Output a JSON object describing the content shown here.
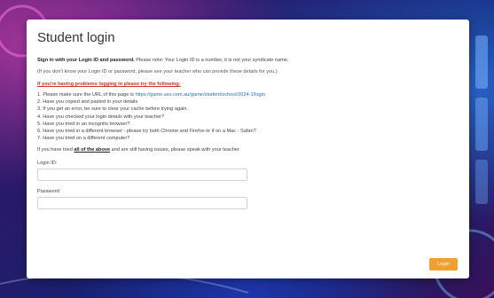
{
  "login": {
    "title": "Student login",
    "intro_bold": "Sign in with your Login ID and password.",
    "intro_rest": " Please note: Your Login ID is a number, it is not your syndicate name.",
    "note": "(If you don't know your Login ID or password, please see your teacher who can provide these details for you.)",
    "trouble_heading": "If you're having problems logging in please try the following:",
    "steps": [
      "1. Please make sure the URL of this page is ",
      "2. Have you copied and pasted in your details",
      "3. If you get an error, be sure to clear your cache before trying again.",
      "4. Have you checked your login details with your teacher?",
      "5. Have you tried in an incognito browser?",
      "6. Have you tried in a different browser - please try both Chrome and Firefox or if on a Mac - Safari?",
      "7. Have you tried on a different computer?"
    ],
    "url_link": "https://game.asx.com.au/game/student/school/2024-1/login",
    "final_pre": "If you have tried ",
    "final_emph": "all of the above",
    "final_post": " and are still having issues, please speak with your teacher.",
    "login_id_label": "Login ID:",
    "login_id_value": "",
    "password_label": "Password:",
    "password_value": "",
    "button_label": "Login",
    "accent_color": "#f0a030"
  }
}
